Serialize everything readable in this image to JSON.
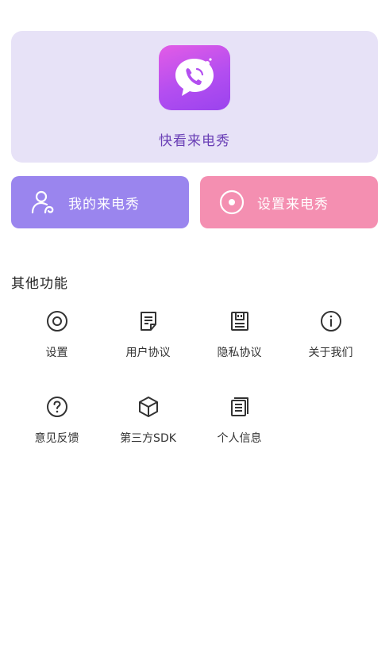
{
  "hero": {
    "app_name": "快看来电秀",
    "logo_icon": "phone-chat-bubble-icon"
  },
  "actions": {
    "my_show": {
      "label": "我的来电秀",
      "icon": "user-icon",
      "color": "#9a85ee"
    },
    "set_show": {
      "label": "设置来电秀",
      "icon": "play-circle-icon",
      "color": "#f48fb1"
    }
  },
  "other": {
    "title": "其他功能",
    "items": [
      {
        "label": "设置",
        "icon": "settings-icon"
      },
      {
        "label": "用户协议",
        "icon": "document-icon"
      },
      {
        "label": "隐私协议",
        "icon": "privacy-document-icon"
      },
      {
        "label": "关于我们",
        "icon": "info-icon"
      },
      {
        "label": "意见反馈",
        "icon": "question-icon"
      },
      {
        "label": "第三方SDK",
        "icon": "cube-icon"
      },
      {
        "label": "个人信息",
        "icon": "personal-info-icon"
      }
    ]
  }
}
